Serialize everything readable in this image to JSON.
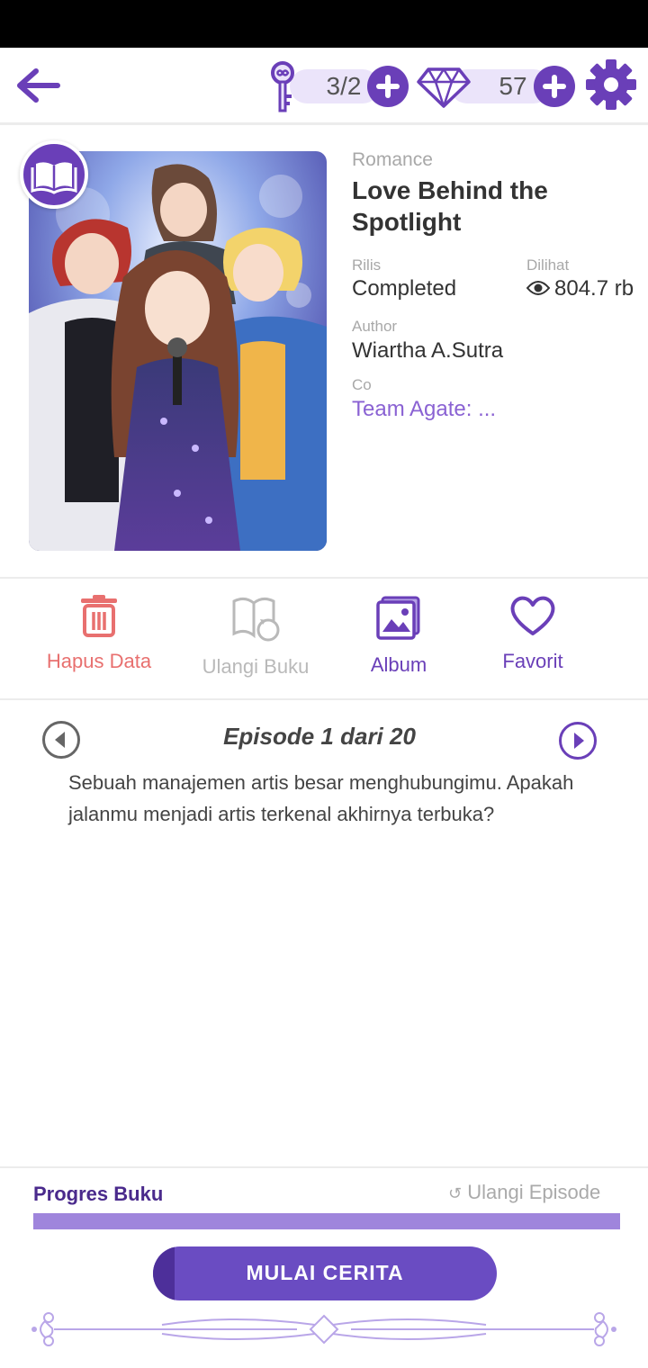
{
  "header": {
    "keys_count": "3/2",
    "gems_count": "57"
  },
  "book": {
    "genre": "Romance",
    "title": "Love Behind the Spotlight",
    "release_label": "Rilis",
    "release_value": "Completed",
    "views_label": "Dilihat",
    "views_value": "804.7 rb",
    "author_label": "Author",
    "author_value": "Wiartha A.Sutra",
    "co_label": "Co",
    "co_value": "Team Agate: ..."
  },
  "actions": [
    {
      "label": "Hapus Data",
      "icon": "trash-icon",
      "color": "#e8706f"
    },
    {
      "label": "Ulangi Buku",
      "icon": "replay-book-icon",
      "color": "#b9b9b9"
    },
    {
      "label": "Album",
      "icon": "album-icon",
      "color": "#6a3fb8"
    },
    {
      "label": "Favorit",
      "icon": "heart-icon",
      "color": "#6a3fb8"
    }
  ],
  "episode": {
    "title": "Episode 1 dari 20",
    "description": "Sebuah manajemen artis besar menghubungimu. Apakah jalanmu menjadi artis terkenal akhirnya terbuka?"
  },
  "progress": {
    "label": "Progres Buku",
    "replay_label": "Ulangi Episode",
    "fraction": 1.0
  },
  "start_button": "MULAI CERITA",
  "colors": {
    "primary": "#6a3fb8",
    "accent_light": "#ebe4fa",
    "delete_red": "#e8706f",
    "link_purple": "#8a62d3"
  }
}
